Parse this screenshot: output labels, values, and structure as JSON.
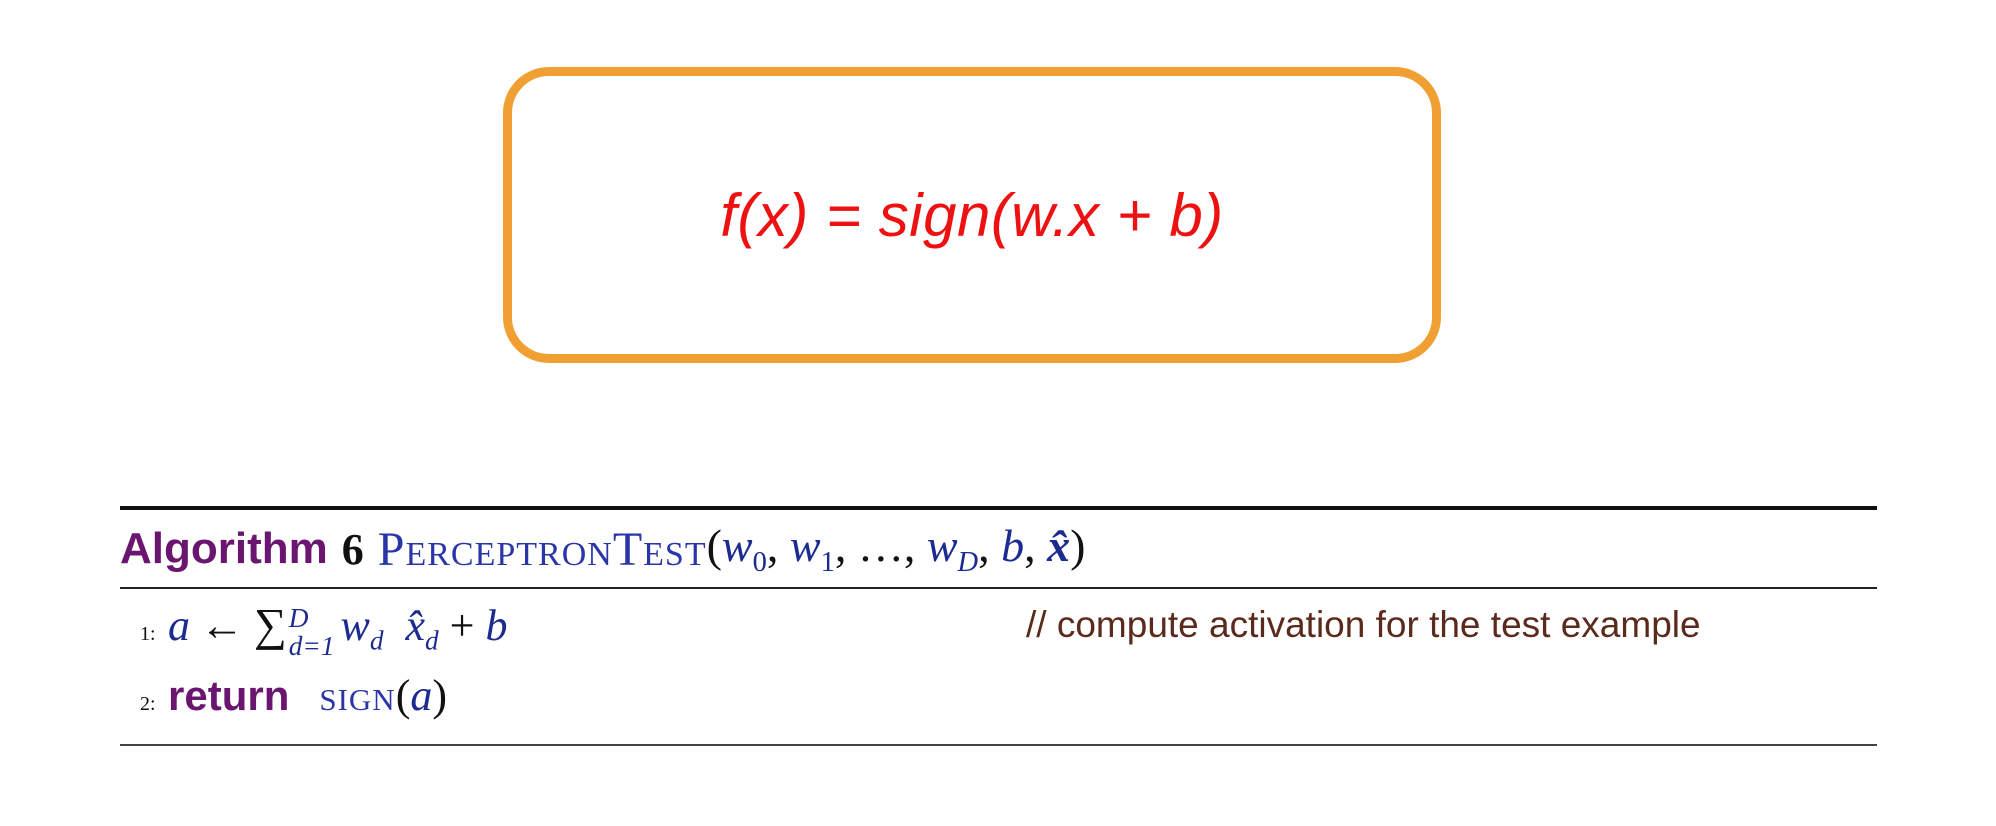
{
  "formula": {
    "text": "f(x) = sign(w.x + b)",
    "text_color": "#ee1111",
    "border_color": "#f0a033"
  },
  "algorithm": {
    "keyword": "Algorithm",
    "number": "6",
    "name": "PerceptronTest",
    "params": {
      "open": "(",
      "w": "w",
      "sub0": "0",
      "sep1": ", ",
      "sub1": "1",
      "sep2": ", …, ",
      "subD": "D",
      "sep3": ", ",
      "b": "b",
      "sep4": ", ",
      "xhat": "x̂",
      "close": ")"
    },
    "keyword_color": "#6a1670",
    "name_color": "#2a36a8",
    "lines": [
      {
        "number": "1:",
        "lhs": "a",
        "arrow": "←",
        "sigma": "∑",
        "sum_upper": "D",
        "sum_lower": "d=1",
        "term_w": "w",
        "term_w_sub": "d",
        "term_x": "x̂",
        "term_x_sub": "d",
        "plus": " + ",
        "b": "b",
        "comment": "// compute activation for the test example"
      },
      {
        "number": "2:",
        "keyword": "return",
        "fn": "sign",
        "open": "(",
        "arg": "a",
        "close": ")"
      }
    ]
  }
}
